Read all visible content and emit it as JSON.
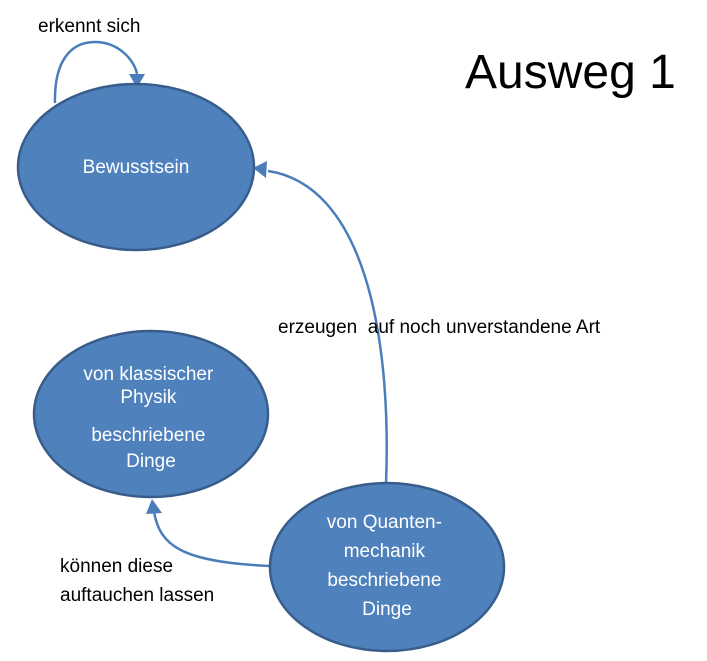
{
  "title": "Ausweg 1",
  "nodes": {
    "bewusstsein": {
      "lines": [
        "Bewusstsein"
      ]
    },
    "klassisch": {
      "lines": [
        "von klassischer",
        "Physik",
        "beschriebene",
        "Dinge"
      ]
    },
    "quanten": {
      "lines": [
        "von Quanten-",
        "mechanik",
        "beschriebene",
        "Dinge"
      ]
    }
  },
  "edges": {
    "self_loop": {
      "lines": [
        "erkennt sich"
      ]
    },
    "quanten_to_bewusstsein": {
      "lines": [
        "erzeugen  auf noch unverstandene Art"
      ]
    },
    "quanten_to_klassisch": {
      "lines": [
        "können diese",
        "auftauchen lassen"
      ]
    }
  },
  "colors": {
    "node_fill": "#4f81bd",
    "node_stroke": "#385d8a",
    "edge": "#4a7ebb",
    "node_text": "#ffffff",
    "label_text": "#000000"
  }
}
